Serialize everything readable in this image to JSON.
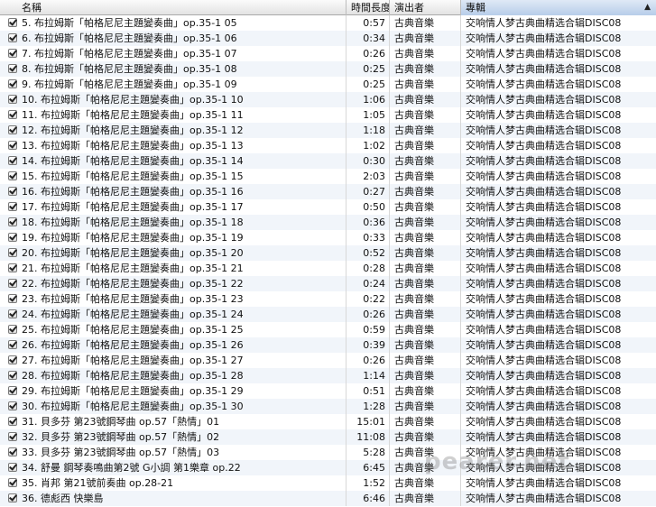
{
  "columns": {
    "name": "名稱",
    "time": "時間長度",
    "artist": "演出者",
    "album": "專輯"
  },
  "sort_indicator": "▲",
  "watermark": "pearer.net",
  "rows": [
    {
      "name": "5. 布拉姆斯「帕格尼尼主題變奏曲」op.35-1 05",
      "time": "0:57",
      "artist": "古典音樂",
      "album": "交响情人梦古典曲精选合辑DISC08"
    },
    {
      "name": "6. 布拉姆斯「帕格尼尼主題變奏曲」op.35-1 06",
      "time": "0:34",
      "artist": "古典音樂",
      "album": "交响情人梦古典曲精选合辑DISC08"
    },
    {
      "name": "7. 布拉姆斯「帕格尼尼主題變奏曲」op.35-1 07",
      "time": "0:26",
      "artist": "古典音樂",
      "album": "交响情人梦古典曲精选合辑DISC08"
    },
    {
      "name": "8. 布拉姆斯「帕格尼尼主題變奏曲」op.35-1 08",
      "time": "0:25",
      "artist": "古典音樂",
      "album": "交响情人梦古典曲精选合辑DISC08"
    },
    {
      "name": "9. 布拉姆斯「帕格尼尼主題變奏曲」op.35-1 09",
      "time": "0:25",
      "artist": "古典音樂",
      "album": "交响情人梦古典曲精选合辑DISC08"
    },
    {
      "name": "10. 布拉姆斯「帕格尼尼主題變奏曲」op.35-1 10",
      "time": "1:06",
      "artist": "古典音樂",
      "album": "交响情人梦古典曲精选合辑DISC08"
    },
    {
      "name": "11. 布拉姆斯「帕格尼尼主題變奏曲」op.35-1 11",
      "time": "1:05",
      "artist": "古典音樂",
      "album": "交响情人梦古典曲精选合辑DISC08"
    },
    {
      "name": "12. 布拉姆斯「帕格尼尼主題變奏曲」op.35-1 12",
      "time": "1:18",
      "artist": "古典音樂",
      "album": "交响情人梦古典曲精选合辑DISC08"
    },
    {
      "name": "13. 布拉姆斯「帕格尼尼主題變奏曲」op.35-1 13",
      "time": "1:02",
      "artist": "古典音樂",
      "album": "交响情人梦古典曲精选合辑DISC08"
    },
    {
      "name": "14. 布拉姆斯「帕格尼尼主題變奏曲」op.35-1 14",
      "time": "0:30",
      "artist": "古典音樂",
      "album": "交响情人梦古典曲精选合辑DISC08"
    },
    {
      "name": "15. 布拉姆斯「帕格尼尼主題變奏曲」op.35-1 15",
      "time": "2:03",
      "artist": "古典音樂",
      "album": "交响情人梦古典曲精选合辑DISC08"
    },
    {
      "name": "16. 布拉姆斯「帕格尼尼主題變奏曲」op.35-1 16",
      "time": "0:27",
      "artist": "古典音樂",
      "album": "交响情人梦古典曲精选合辑DISC08"
    },
    {
      "name": "17. 布拉姆斯「帕格尼尼主題變奏曲」op.35-1 17",
      "time": "0:50",
      "artist": "古典音樂",
      "album": "交响情人梦古典曲精选合辑DISC08"
    },
    {
      "name": "18. 布拉姆斯「帕格尼尼主題變奏曲」op.35-1 18",
      "time": "0:36",
      "artist": "古典音樂",
      "album": "交响情人梦古典曲精选合辑DISC08"
    },
    {
      "name": "19. 布拉姆斯「帕格尼尼主題變奏曲」op.35-1 19",
      "time": "0:33",
      "artist": "古典音樂",
      "album": "交响情人梦古典曲精选合辑DISC08"
    },
    {
      "name": "20. 布拉姆斯「帕格尼尼主題變奏曲」op.35-1 20",
      "time": "0:52",
      "artist": "古典音樂",
      "album": "交响情人梦古典曲精选合辑DISC08"
    },
    {
      "name": "21. 布拉姆斯「帕格尼尼主題變奏曲」op.35-1 21",
      "time": "0:28",
      "artist": "古典音樂",
      "album": "交响情人梦古典曲精选合辑DISC08"
    },
    {
      "name": "22. 布拉姆斯「帕格尼尼主題變奏曲」op.35-1 22",
      "time": "0:24",
      "artist": "古典音樂",
      "album": "交响情人梦古典曲精选合辑DISC08"
    },
    {
      "name": "23. 布拉姆斯「帕格尼尼主題變奏曲」op.35-1 23",
      "time": "0:22",
      "artist": "古典音樂",
      "album": "交响情人梦古典曲精选合辑DISC08"
    },
    {
      "name": "24. 布拉姆斯「帕格尼尼主題變奏曲」op.35-1 24",
      "time": "0:26",
      "artist": "古典音樂",
      "album": "交响情人梦古典曲精选合辑DISC08"
    },
    {
      "name": "25. 布拉姆斯「帕格尼尼主題變奏曲」op.35-1 25",
      "time": "0:59",
      "artist": "古典音樂",
      "album": "交响情人梦古典曲精选合辑DISC08"
    },
    {
      "name": "26. 布拉姆斯「帕格尼尼主題變奏曲」op.35-1 26",
      "time": "0:39",
      "artist": "古典音樂",
      "album": "交响情人梦古典曲精选合辑DISC08"
    },
    {
      "name": "27. 布拉姆斯「帕格尼尼主題變奏曲」op.35-1 27",
      "time": "0:26",
      "artist": "古典音樂",
      "album": "交响情人梦古典曲精选合辑DISC08"
    },
    {
      "name": "28. 布拉姆斯「帕格尼尼主題變奏曲」op.35-1 28",
      "time": "1:14",
      "artist": "古典音樂",
      "album": "交响情人梦古典曲精选合辑DISC08"
    },
    {
      "name": "29. 布拉姆斯「帕格尼尼主題變奏曲」op.35-1 29",
      "time": "0:51",
      "artist": "古典音樂",
      "album": "交响情人梦古典曲精选合辑DISC08"
    },
    {
      "name": "30. 布拉姆斯「帕格尼尼主題變奏曲」op.35-1 30",
      "time": "1:28",
      "artist": "古典音樂",
      "album": "交响情人梦古典曲精选合辑DISC08"
    },
    {
      "name": "31. 貝多芬 第23號鋼琴曲 op.57「熱情」01",
      "time": "15:01",
      "artist": "古典音樂",
      "album": "交响情人梦古典曲精选合辑DISC08"
    },
    {
      "name": "32. 貝多芬 第23號鋼琴曲 op.57「熱情」02",
      "time": "11:08",
      "artist": "古典音樂",
      "album": "交响情人梦古典曲精选合辑DISC08"
    },
    {
      "name": "33. 貝多芬 第23號鋼琴曲 op.57「熱情」03",
      "time": "5:28",
      "artist": "古典音樂",
      "album": "交响情人梦古典曲精选合辑DISC08"
    },
    {
      "name": "34. 舒曼 鋼琴奏鳴曲第2號 G小調 第1樂章 op.22",
      "time": "6:45",
      "artist": "古典音樂",
      "album": "交响情人梦古典曲精选合辑DISC08"
    },
    {
      "name": "35. 肖邦 第21號前奏曲 op.28-21",
      "time": "1:52",
      "artist": "古典音樂",
      "album": "交响情人梦古典曲精选合辑DISC08"
    },
    {
      "name": "36. 德彪西 快樂島",
      "time": "6:46",
      "artist": "古典音樂",
      "album": "交响情人梦古典曲精选合辑DISC08"
    }
  ]
}
